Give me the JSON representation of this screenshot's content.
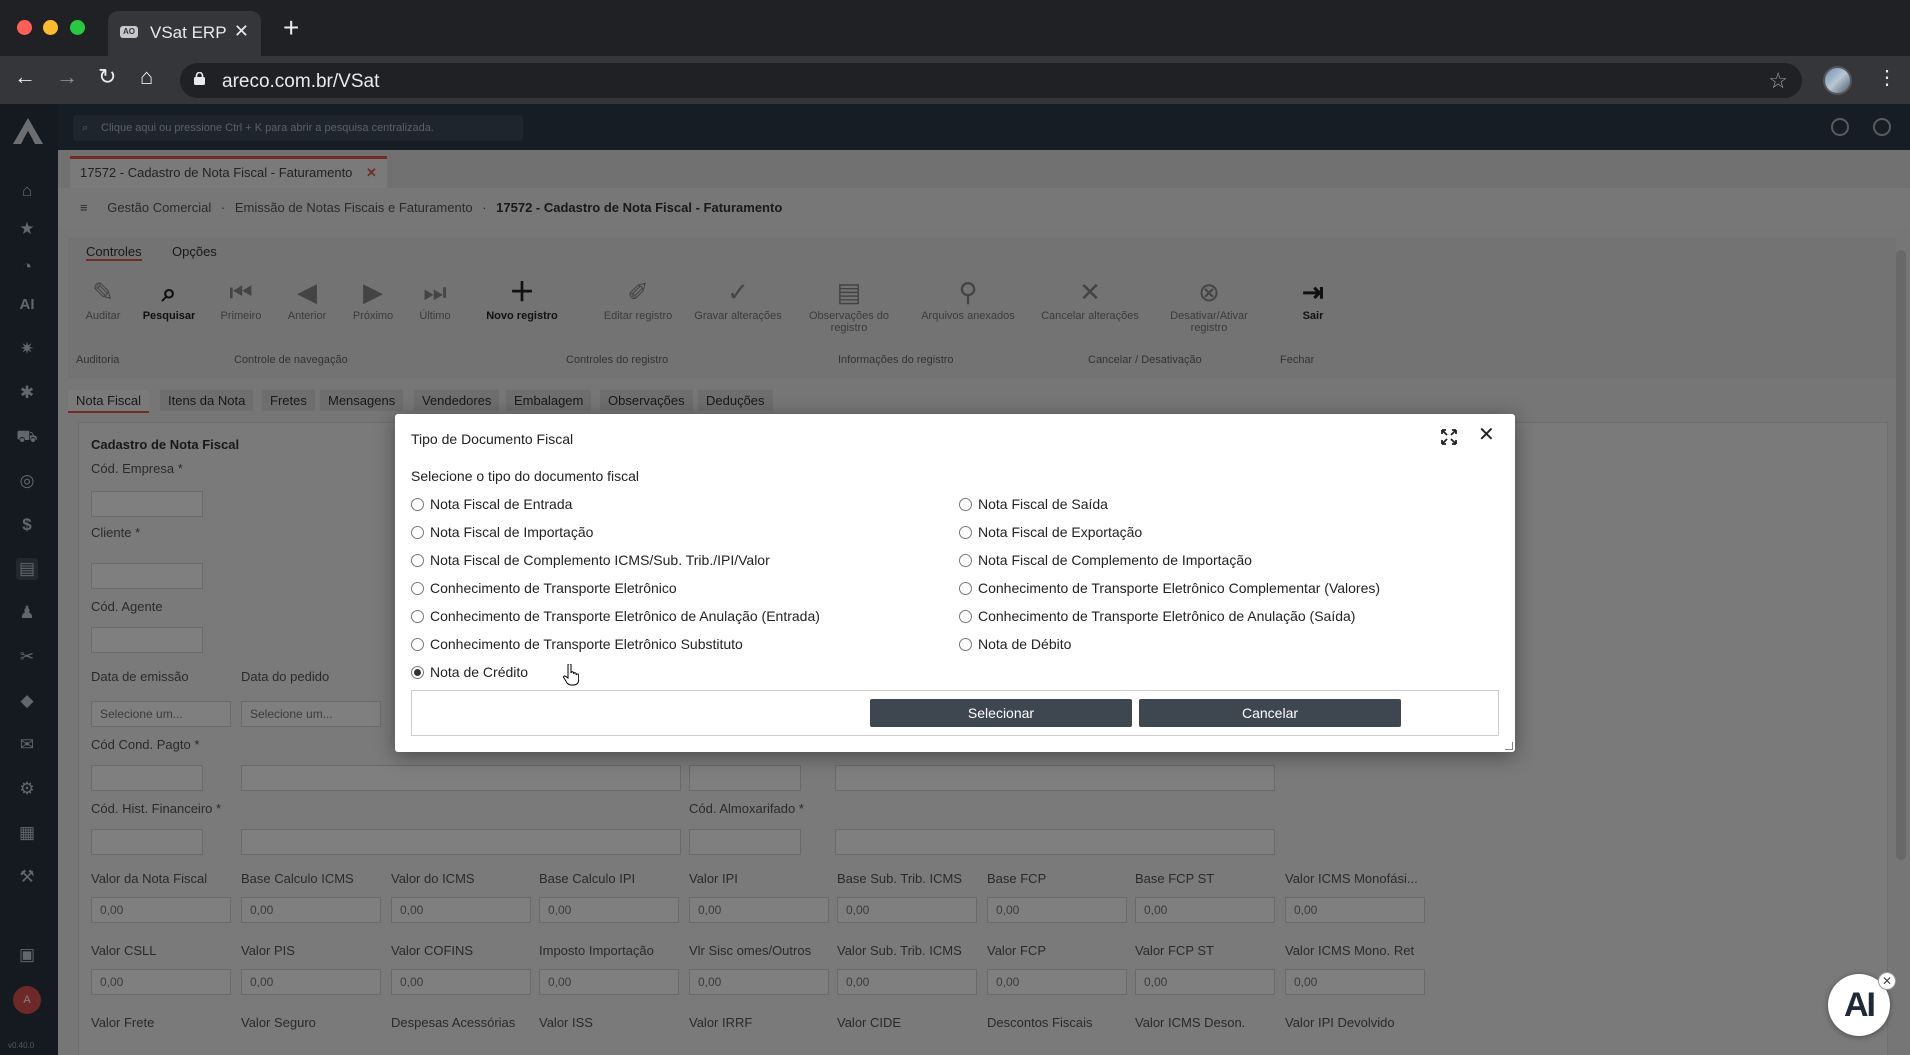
{
  "browser": {
    "tab_title": "VSat ERP",
    "favicon_text": "AO",
    "url": "areco.com.br/VSat"
  },
  "app": {
    "search_placeholder": "Clique aqui ou pressione Ctrl + K para abrir a pesquisa centralizada.",
    "doc_tab": "17572 - Cadastro de Nota Fiscal - Faturamento",
    "breadcrumb": [
      "Gestão Comercial",
      "Emissão de Notas Fiscais e Faturamento",
      "17572 - Cadastro de Nota Fiscal - Faturamento"
    ],
    "ribbon_tabs": [
      "Controles",
      "Opções"
    ],
    "ribbon_buttons": [
      {
        "label": "Auditar",
        "icon": "audit-icon"
      },
      {
        "label": "Pesquisar",
        "icon": "search-icon"
      },
      {
        "label": "Primeiro",
        "icon": "first-icon"
      },
      {
        "label": "Anterior",
        "icon": "previous-icon"
      },
      {
        "label": "Próximo",
        "icon": "next-icon"
      },
      {
        "label": "Último",
        "icon": "last-icon"
      },
      {
        "label": "Novo registro",
        "icon": "plus-icon"
      },
      {
        "label": "Editar registro",
        "icon": "edit-icon"
      },
      {
        "label": "Gravar alterações",
        "icon": "check-icon"
      },
      {
        "label": "Observações do registro",
        "icon": "notes-icon"
      },
      {
        "label": "Arquivos anexados",
        "icon": "paperclip-icon"
      },
      {
        "label": "Cancelar alterações",
        "icon": "x-icon"
      },
      {
        "label": "Desativar/Ativar registro",
        "icon": "deactivate-icon"
      },
      {
        "label": "Sair",
        "icon": "exit-icon"
      }
    ],
    "ribbon_groups": [
      "Auditoria",
      "Controle de navegação",
      "Controles do registro",
      "Informações do registro",
      "Cancelar / Desativação",
      "Fechar"
    ],
    "form_tabs": [
      "Nota Fiscal",
      "Itens da Nota",
      "Fretes",
      "Mensagens",
      "Vendedores",
      "Embalagem",
      "Observações",
      "Deduções"
    ],
    "form": {
      "section_title": "Cadastro de Nota Fiscal",
      "labels": [
        "Cód. Empresa *",
        "Cliente *",
        "Cód. Agente",
        "Data de emissão",
        "Data do pedido",
        "Cód Cond. Pagto *",
        "Cód. Hist. Financeiro *",
        "Cód. Almoxarifado *"
      ],
      "date_placeholder": "Selecione um...",
      "value_labels_row1": [
        "Valor da Nota Fiscal",
        "Base Calculo ICMS",
        "Valor do ICMS",
        "Base Calculo IPI",
        "Valor IPI",
        "Base Sub. Trib. ICMS",
        "Base FCP",
        "Base FCP ST",
        "Valor ICMS Monofási..."
      ],
      "value_labels_row2": [
        "Valor CSLL",
        "Valor PIS",
        "Valor COFINS",
        "Imposto Importação",
        "Vlr Sisc omes/Outros",
        "Valor Sub. Trib. ICMS",
        "Valor FCP",
        "Valor FCP ST",
        "Valor ICMS Mono. Ret"
      ],
      "value_labels_row3": [
        "Valor Frete",
        "Valor Seguro",
        "Despesas Acessórias",
        "Valor ISS",
        "Valor IRRF",
        "Valor CIDE",
        "Descontos Fiscais",
        "Valor ICMS Deson.",
        "Valor IPI Devolvido"
      ],
      "zero_value": "0,00"
    },
    "user_initial": "A",
    "version": "v0.40.0",
    "ai_badge": "AI"
  },
  "dialog": {
    "title": "Tipo de Documento Fiscal",
    "subtitle": "Selecione o tipo do documento fiscal",
    "options_left": [
      "Nota Fiscal de Entrada",
      "Nota Fiscal de Importação",
      "Nota Fiscal de Complemento ICMS/Sub. Trib./IPI/Valor",
      "Conhecimento de Transporte Eletrônico",
      "Conhecimento de Transporte Eletrônico de Anulação (Entrada)",
      "Conhecimento de Transporte Eletrônico Substituto",
      "Nota de Crédito"
    ],
    "options_right": [
      "Nota Fiscal de Saída",
      "Nota Fiscal de Exportação",
      "Nota Fiscal de Complemento de Importação",
      "Conhecimento de Transporte Eletrônico Complementar (Valores)",
      "Conhecimento de Transporte Eletrônico de Anulação (Saída)",
      "Nota de Débito"
    ],
    "selected": "Nota de Crédito",
    "select_button": "Selecionar",
    "cancel_button": "Cancelar"
  }
}
